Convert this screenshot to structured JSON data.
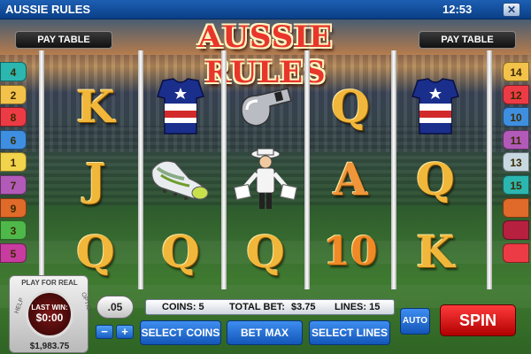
{
  "window": {
    "title": "AUSSIE RULES",
    "clock": "12:53",
    "close_glyph": "✕"
  },
  "game": {
    "logo": "AUSSIE RULES",
    "paytable_left": "PAY TABLE",
    "paytable_right": "PAY TABLE"
  },
  "left_lines": [
    "4",
    "2",
    "8",
    "6",
    "1",
    "7",
    "9",
    "3",
    "5"
  ],
  "right_lines": [
    "14",
    "12",
    "10",
    "11",
    "13",
    "15"
  ],
  "line_colors_left": [
    "#2bb6b0",
    "#f2c24a",
    "#ed3b45",
    "#3f8fe0",
    "#f2d34c",
    "#b25ab8",
    "#e06a2a",
    "#4fb84a",
    "#c83ca0"
  ],
  "line_colors_right": [
    "#f2c24a",
    "#ed3b45",
    "#3f8fe0",
    "#b25ab8",
    "#c8d8e0",
    "#2bb6b0",
    "#e06a2a",
    "#b82040",
    "#ed3b45"
  ],
  "right_lines_full": [
    "14",
    "12",
    "10",
    "11",
    "13",
    "15"
  ],
  "reels": [
    [
      "K",
      "J",
      "Q"
    ],
    [
      "guernsey",
      "boots",
      "Q"
    ],
    [
      "whistle",
      "umpire",
      "Q"
    ],
    [
      "Q",
      "A",
      "10"
    ],
    [
      "guernsey",
      "Q",
      "K"
    ]
  ],
  "bottom": {
    "play_for_real": "PLAY FOR REAL",
    "last_win_label": "LAST WIN:",
    "last_win_value": "$0:00",
    "balance": "$1,983.75",
    "help": "HELP",
    "options": "OPTIONS",
    "coin_value": ".05",
    "minus": "−",
    "plus": "+",
    "coins_label": "COINS: 5",
    "total_bet_label": "TOTAL BET:",
    "total_bet_value": "$3.75",
    "lines_label": "LINES: 15",
    "select_coins": "SELECT COINS",
    "bet_max": "BET MAX",
    "select_lines": "SELECT LINES",
    "auto": "AUTO",
    "spin": "SPIN"
  }
}
